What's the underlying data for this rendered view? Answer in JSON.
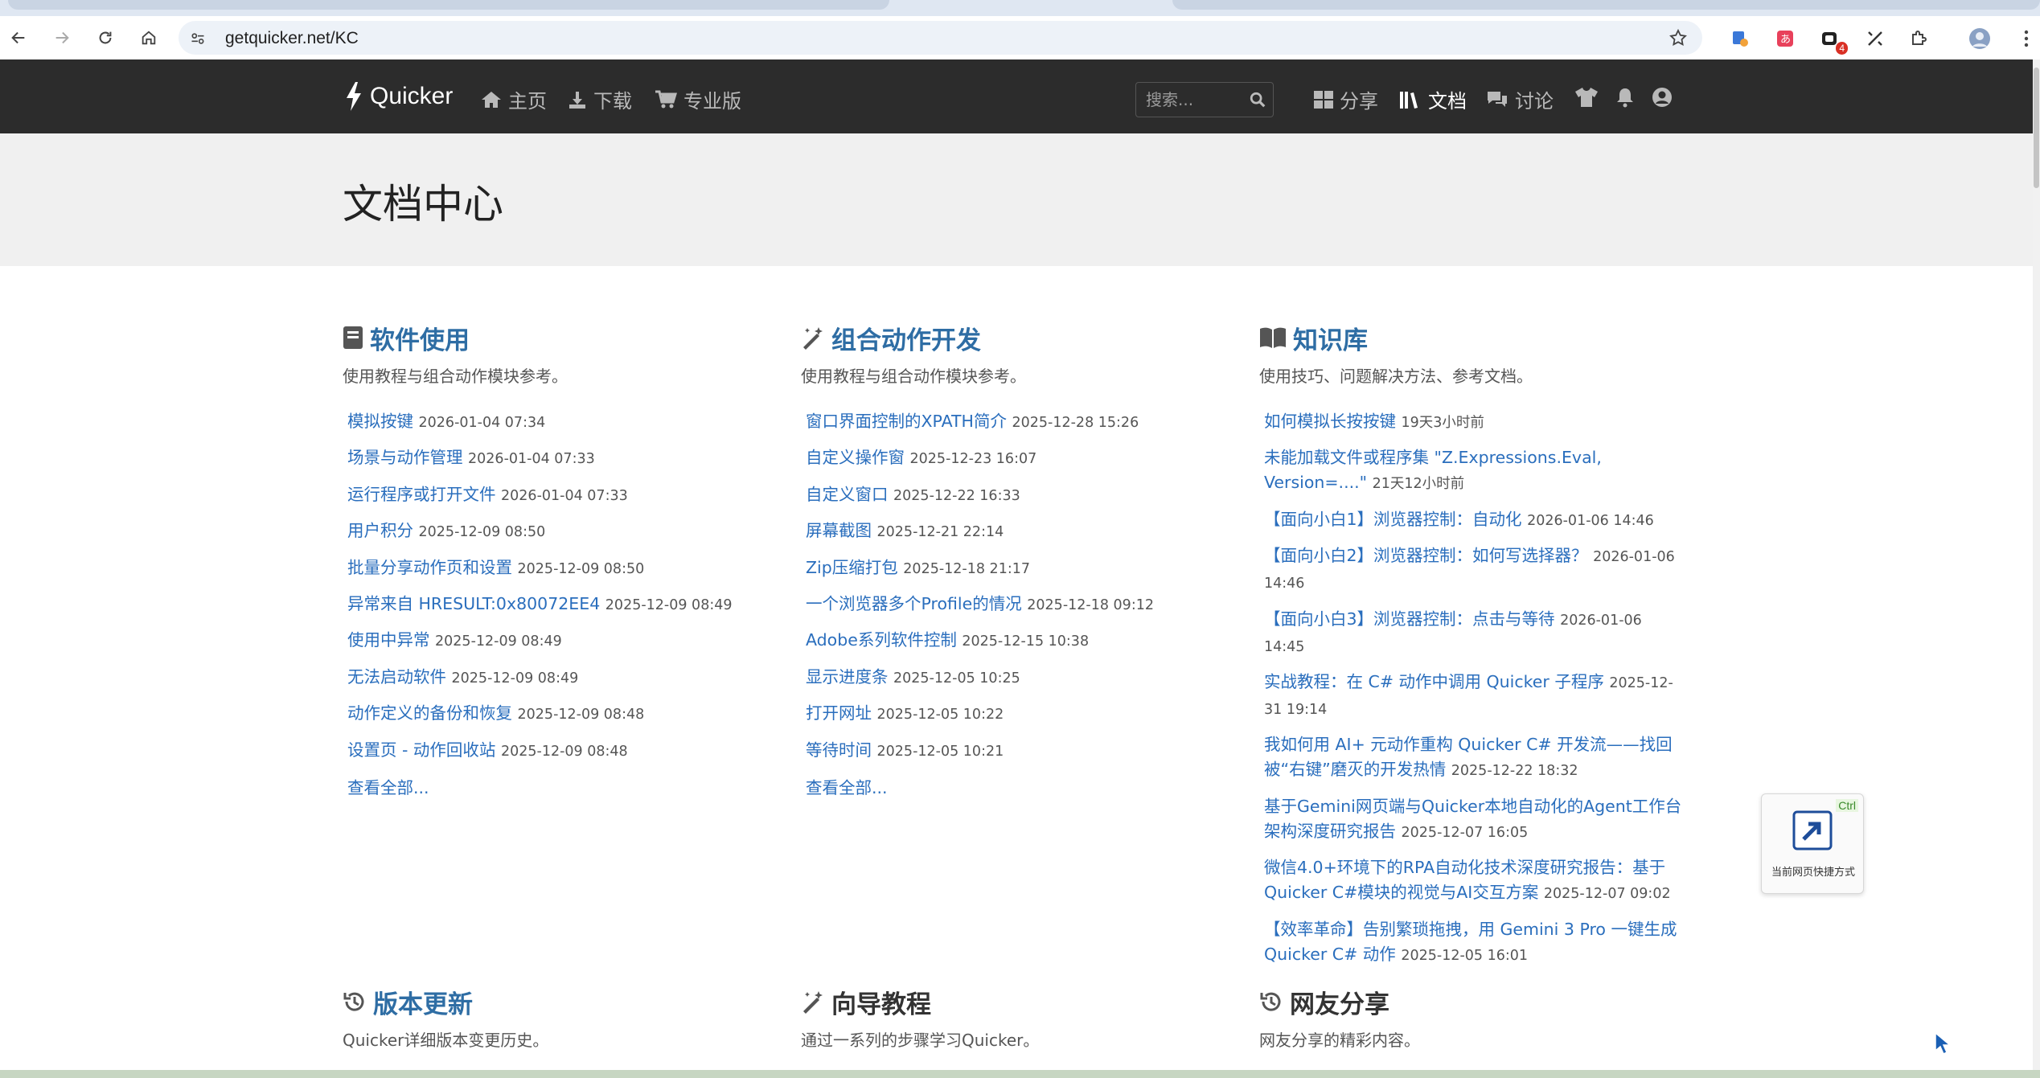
{
  "browser": {
    "url": "getquicker.net/KC",
    "notification_badge": "4"
  },
  "navbar": {
    "brand": "Quicker",
    "links": {
      "home": "主页",
      "download": "下载",
      "pro": "专业版",
      "share": "分享",
      "docs": "文档",
      "discuss": "讨论"
    },
    "search_placeholder": "搜索..."
  },
  "page": {
    "title": "文档中心"
  },
  "sections": {
    "software": {
      "title": "软件使用",
      "desc": "使用教程与组合动作模块参考。",
      "items": [
        {
          "title": "模拟按键",
          "date": "2026-01-04 07:34"
        },
        {
          "title": "场景与动作管理",
          "date": "2026-01-04 07:33"
        },
        {
          "title": "运行程序或打开文件",
          "date": "2026-01-04 07:33"
        },
        {
          "title": "用户积分",
          "date": "2025-12-09 08:50"
        },
        {
          "title": "批量分享动作页和设置",
          "date": "2025-12-09 08:50"
        },
        {
          "title": "异常来自 HRESULT:0x80072EE4",
          "date": "2025-12-09 08:49"
        },
        {
          "title": "使用中异常",
          "date": "2025-12-09 08:49"
        },
        {
          "title": "无法启动软件",
          "date": "2025-12-09 08:49"
        },
        {
          "title": "动作定义的备份和恢复",
          "date": "2025-12-09 08:48"
        },
        {
          "title": "设置页 - 动作回收站",
          "date": "2025-12-09 08:48"
        }
      ],
      "more": "查看全部..."
    },
    "dev": {
      "title": "组合动作开发",
      "desc": "使用教程与组合动作模块参考。",
      "items": [
        {
          "title": "窗口界面控制的XPATH简介",
          "date": "2025-12-28 15:26"
        },
        {
          "title": "自定义操作窗",
          "date": "2025-12-23 16:07"
        },
        {
          "title": "自定义窗口",
          "date": "2025-12-22 16:33"
        },
        {
          "title": "屏幕截图",
          "date": "2025-12-21 22:14"
        },
        {
          "title": "Zip压缩打包",
          "date": "2025-12-18 21:17"
        },
        {
          "title": "一个浏览器多个Profile的情况",
          "date": "2025-12-18 09:12"
        },
        {
          "title": "Adobe系列软件控制",
          "date": "2025-12-15 10:38"
        },
        {
          "title": "显示进度条",
          "date": "2025-12-05 10:25"
        },
        {
          "title": "打开网址",
          "date": "2025-12-05 10:22"
        },
        {
          "title": "等待时间",
          "date": "2025-12-05 10:21"
        }
      ],
      "more": "查看全部..."
    },
    "kb": {
      "title": "知识库",
      "desc": "使用技巧、问题解决方法、参考文档。",
      "items": [
        {
          "title": "如何模拟长按按键",
          "date": "19天3小时前"
        },
        {
          "title": "未能加载文件或程序集 \"Z.Expressions.Eval, Version=....\"",
          "date": "21天12小时前"
        },
        {
          "title": "【面向小白1】浏览器控制：自动化",
          "date": "2026-01-06 14:46"
        },
        {
          "title": "【面向小白2】浏览器控制：如何写选择器？",
          "date": "2026-01-06 14:46"
        },
        {
          "title": "【面向小白3】浏览器控制：点击与等待",
          "date": "2026-01-06 14:45"
        },
        {
          "title": "实战教程：在 C# 动作中调用 Quicker 子程序",
          "date": "2025-12-31 19:14"
        },
        {
          "title": "我如何用 AI+ 元动作重构 Quicker C# 开发流——找回被“右键”磨灭的开发热情",
          "date": "2025-12-22 18:32"
        },
        {
          "title": "基于Gemini网页端与Quicker本地自动化的Agent工作台架构深度研究报告",
          "date": "2025-12-07 16:05"
        },
        {
          "title": "微信4.0+环境下的RPA自动化技术深度研究报告：基于Quicker C#模块的视觉与AI交互方案",
          "date": "2025-12-07 09:02"
        },
        {
          "title": "【效率革命】告别繁琐拖拽，用 Gemini 3 Pro 一键生成 Quicker C# 动作",
          "date": "2025-12-05 16:01"
        }
      ]
    },
    "updates": {
      "title": "版本更新",
      "desc": "Quicker详细版本变更历史。"
    },
    "guide": {
      "title": "向导教程",
      "desc": "通过一系列的步骤学习Quicker。"
    },
    "community": {
      "title": "网友分享",
      "desc": "网友分享的精彩内容。"
    }
  },
  "widget": {
    "label": "当前网页快捷方式",
    "key": "Ctrl"
  },
  "colors": {
    "navbar_bg": "#2c2c2c",
    "link": "#2a6ebd",
    "heading_blue": "#2e6da4",
    "jumbotron_bg": "#f0f0f0"
  }
}
